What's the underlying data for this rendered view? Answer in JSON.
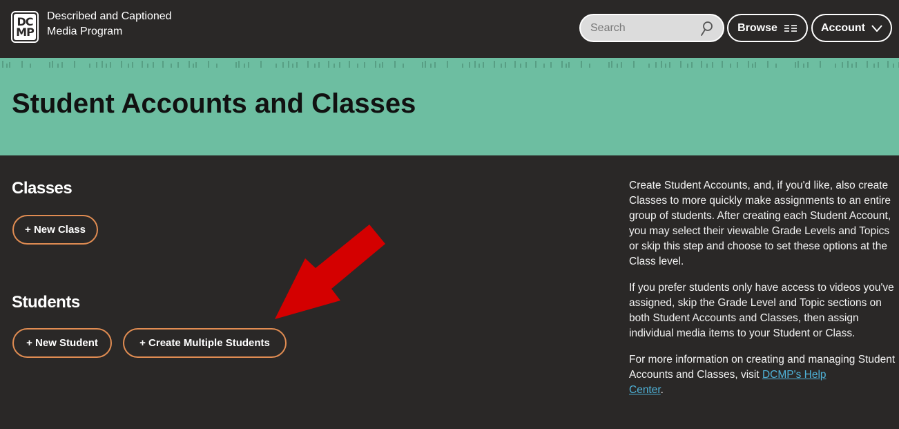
{
  "header": {
    "logo": {
      "line1": "DC",
      "line2": "MP"
    },
    "site_name_line1": "Described and Captioned",
    "site_name_line2": "Media Program",
    "search": {
      "placeholder": "Search",
      "value": "",
      "icon": "search-icon"
    },
    "browse_label": "Browse",
    "browse_icon": "list-icon",
    "account_label": "Account",
    "account_icon": "chevron-down-icon"
  },
  "banner": {
    "title": "Student Accounts and Classes"
  },
  "classes": {
    "heading": "Classes",
    "new_class_label": "+ New Class"
  },
  "students": {
    "heading": "Students",
    "new_student_label": "+ New Student",
    "create_multiple_label": "+ Create Multiple Students"
  },
  "annotation": {
    "arrow_color": "#d40000",
    "points_to": "create-multiple-students-button"
  },
  "info": {
    "para1": "Create Student Accounts, and, if you'd like, also create Classes to more quickly make assignments to an entire group of students. After creating each Student Account, you may select their viewable Grade Levels and Topics or skip this step and choose to set these options at the Class level.",
    "para2": "If you prefer students only have access to videos you've assigned, skip the Grade Level and Topic sections on both Student Accounts and Classes, then assign individual media items to your Student or Class.",
    "para3_prefix": "For more information on creating and managing Student Accounts and Classes, visit ",
    "help_link_line1": "DCMP's Help",
    "help_link_line2": "Center",
    "para3_suffix": "."
  },
  "colors": {
    "background": "#2a2827",
    "banner": "#6dbea1",
    "button_border": "#e08c52",
    "link": "#4fb3d9",
    "arrow": "#d40000"
  }
}
